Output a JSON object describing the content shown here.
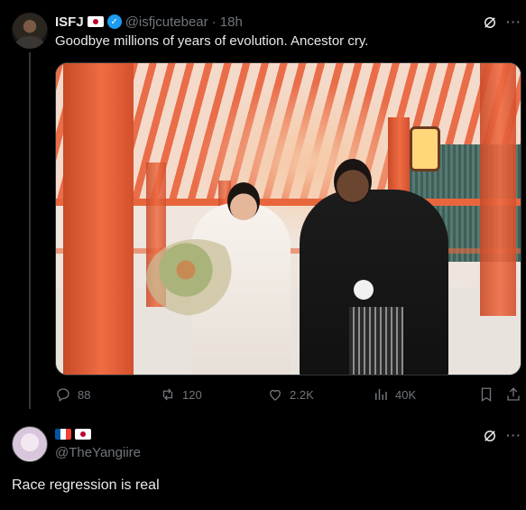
{
  "tweet": {
    "author_name": "ISFJ",
    "author_handle": "@isfjcutebear",
    "time": "· 18h",
    "text": "Goodbye millions of years of evolution. Ancestor cry.",
    "stats": {
      "replies": "88",
      "reposts": "120",
      "likes": "2.2K",
      "views": "40K"
    }
  },
  "reply": {
    "author_handle": "@TheYangiire",
    "text": "Race regression is real"
  },
  "colors": {
    "background": "#000000",
    "text_primary": "#e7e9ea",
    "text_secondary": "#71767b",
    "verified": "#1d9bf0",
    "divider": "#333639"
  },
  "icons": [
    "grok-icon",
    "more-icon",
    "reply-icon",
    "repost-icon",
    "like-icon",
    "views-icon",
    "bookmark-icon",
    "share-icon",
    "verified-icon",
    "flag-japan-icon",
    "flag-france-icon"
  ]
}
